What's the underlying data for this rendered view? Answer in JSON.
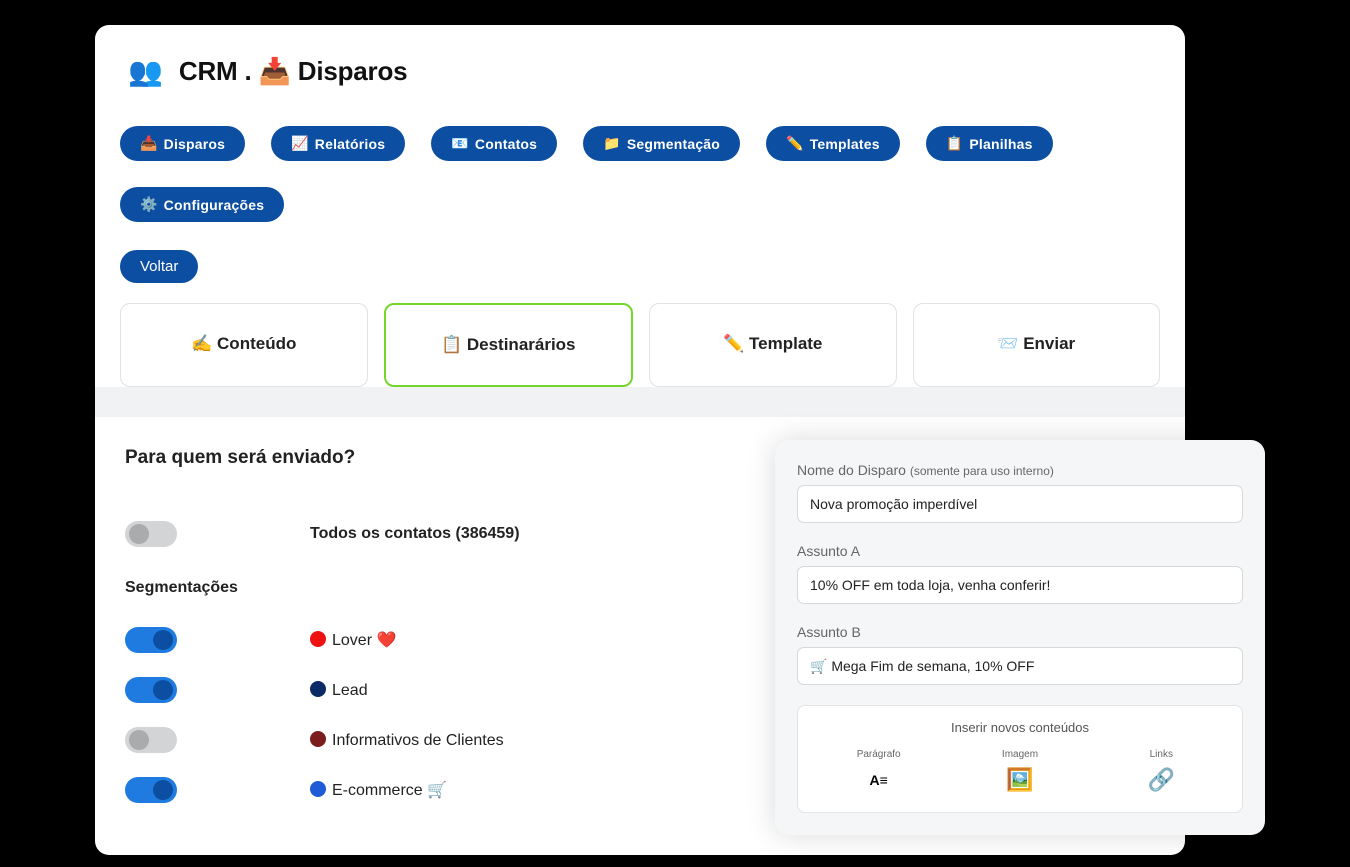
{
  "header": {
    "logo_emoji": "👥",
    "title": "CRM . 📥 Disparos"
  },
  "nav": [
    {
      "icon": "📥",
      "label": "Disparos"
    },
    {
      "icon": "📈",
      "label": "Relatórios"
    },
    {
      "icon": "📧",
      "label": "Contatos"
    },
    {
      "icon": "📁",
      "label": "Segmentação"
    },
    {
      "icon": "✏️",
      "label": "Templates"
    },
    {
      "icon": "📋",
      "label": "Planilhas"
    },
    {
      "icon": "⚙️",
      "label": "Configurações"
    }
  ],
  "back_label": "Voltar",
  "steps": [
    {
      "icon": "✍️",
      "label": "Conteúdo",
      "active": false
    },
    {
      "icon": "📋",
      "label": "Destinarários",
      "active": true
    },
    {
      "icon": "✏️",
      "label": "Template",
      "active": false
    },
    {
      "icon": "📨",
      "label": "Enviar",
      "active": false
    }
  ],
  "recipients": {
    "heading": "Para quem será enviado?",
    "all_contacts": {
      "label": "Todos os contatos (386459)",
      "on": false
    },
    "segments_title": "Segmentações",
    "segments": [
      {
        "on": true,
        "color": "#e11",
        "label": "Lover ❤️"
      },
      {
        "on": true,
        "color": "#0b2a66",
        "label": "Lead"
      },
      {
        "on": false,
        "color": "#7a1d1d",
        "label": "Informativos de Clientes"
      },
      {
        "on": true,
        "color": "#1f5bd6",
        "label": "E-commerce 🛒"
      }
    ]
  },
  "overlay": {
    "name_label": "Nome do Disparo",
    "name_hint": "(somente para uso interno)",
    "name_value": "Nova promoção imperdível",
    "subject_a_label": "Assunto A",
    "subject_a_value": "10% OFF em toda loja, venha conferir!",
    "subject_b_label": "Assunto B",
    "subject_b_value": "🛒 Mega Fim de semana, 10% OFF",
    "insert_title": "Inserir novos conteúdos",
    "insert_items": [
      {
        "label": "Parágrafo",
        "glyph": "A≡"
      },
      {
        "label": "Imagem",
        "glyph": "🖼️"
      },
      {
        "label": "Links",
        "glyph": "🔗"
      }
    ]
  }
}
